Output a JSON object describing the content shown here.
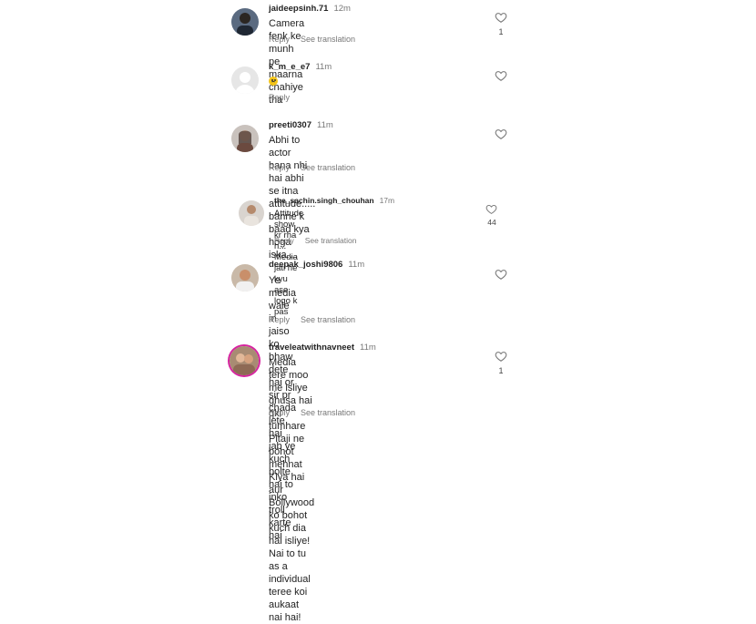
{
  "actions": {
    "reply": "Reply",
    "see_translation": "See translation"
  },
  "comments": [
    {
      "user": "jaideepsinh.71",
      "time": "12m",
      "lines": [
        "Camera fenk ke munh pe maarna chahiye tha"
      ],
      "likes": "1",
      "translation": true
    },
    {
      "user": "k_m_e_e7",
      "time": "11m",
      "lines": [],
      "emoji": "crying-face",
      "likes": "",
      "translation": false
    },
    {
      "user": "preeti0307",
      "time": "11m",
      "lines": [
        "Abhi to actor bana nhi hai abhi se itna",
        "attitude..... banne k baad kya hoga iska...."
      ],
      "likes": "",
      "translation": true
    },
    {
      "user": "the_sachin.singh_chouhan",
      "time": "17m",
      "lines": [
        "Attitude show kr rha h... Media jati he kyu ase",
        "logo k pas"
      ],
      "likes": "44",
      "translation": true
    },
    {
      "user": "deepak_joshi9806",
      "time": "11m",
      "lines": [
        "Ye media wale in jaiso ko bhaw dete hai or sir pr",
        "chada lete hai jab ye kuch bolte hai to inko troll",
        "karte hai"
      ],
      "likes": "",
      "translation": true
    },
    {
      "user": "traveleatwithnavneet",
      "time": "11m",
      "lines": [
        "Media tere moo me isliye ghusa hai qki tumhare",
        "Pitaji ne bohot mehnat Kiya hai aur Bollywood",
        "ko bohot kuch dia hai isliye! Nai to tu as a",
        "individual teree koi aukaat nai hai!"
      ],
      "likes": "1",
      "translation": true
    }
  ]
}
